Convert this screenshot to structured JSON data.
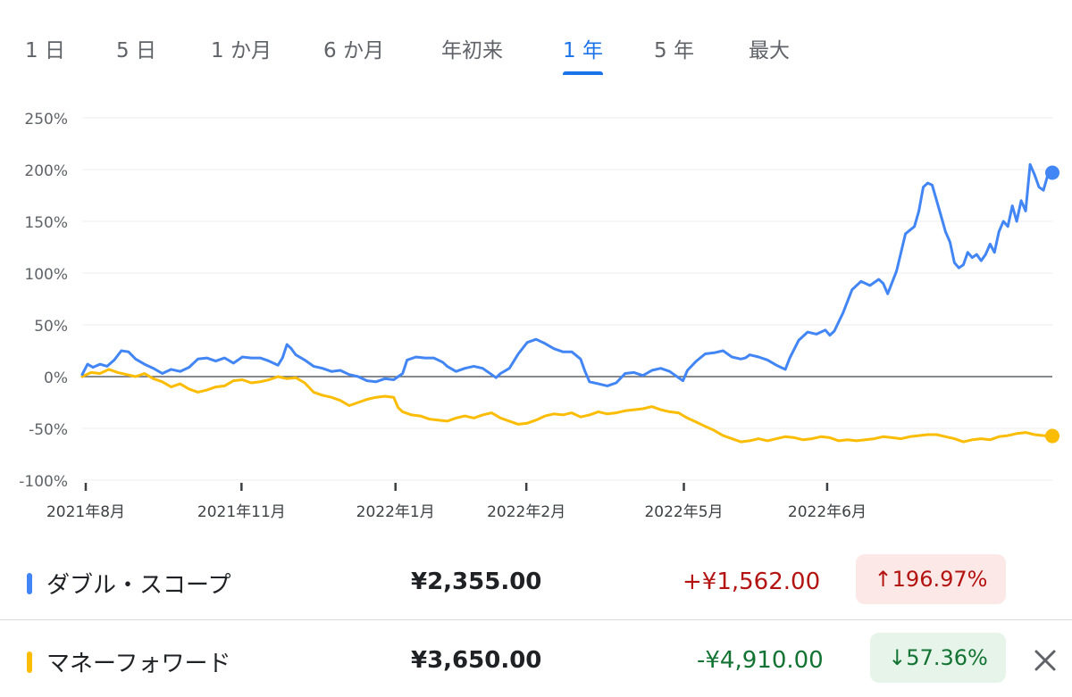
{
  "tabs": [
    {
      "label": "1 日",
      "active": false
    },
    {
      "label": "5 日",
      "active": false
    },
    {
      "label": "1 か月",
      "active": false
    },
    {
      "label": "6 か月",
      "active": false
    },
    {
      "label": "年初来",
      "active": false
    },
    {
      "label": "1 年",
      "active": true
    },
    {
      "label": "5 年",
      "active": false
    },
    {
      "label": "最大",
      "active": false
    }
  ],
  "colors": {
    "accent": "#1a73e8",
    "series_blue": "#4285f4",
    "series_yellow": "#fbbc04",
    "negative_text": "#b31412",
    "negative_badge_bg": "#fce8e6",
    "positive_text": "#137333",
    "positive_badge_bg": "#e6f4ea"
  },
  "chart_data": {
    "type": "line",
    "y_unit": "%",
    "ylim": [
      -100,
      250
    ],
    "yticks": [
      -100,
      -50,
      0,
      50,
      100,
      150,
      200,
      250
    ],
    "ytick_labels": [
      "-100%",
      "-50%",
      "0%",
      "50%",
      "100%",
      "150%",
      "200%",
      "250%"
    ],
    "xlim": [
      0,
      1
    ],
    "xticks": [
      {
        "pos": 0.004,
        "label": "2021年8月"
      },
      {
        "pos": 0.179,
        "label": "2021年11月"
      },
      {
        "pos": 0.352,
        "label": "2022年1月"
      },
      {
        "pos": 0.499,
        "label": "2022年2月"
      },
      {
        "pos": 0.676,
        "label": "2022年5月"
      },
      {
        "pos": 0.837,
        "label": "2022年6月"
      }
    ],
    "zero_line": true,
    "grid": true,
    "series": [
      {
        "name": "ダブル・スコープ",
        "color": "#4285f4",
        "end_marker": true,
        "points": [
          [
            0.0,
            2
          ],
          [
            0.006,
            12
          ],
          [
            0.012,
            9
          ],
          [
            0.02,
            12
          ],
          [
            0.028,
            10
          ],
          [
            0.036,
            16
          ],
          [
            0.044,
            25
          ],
          [
            0.052,
            24
          ],
          [
            0.06,
            17
          ],
          [
            0.07,
            12
          ],
          [
            0.08,
            8
          ],
          [
            0.09,
            3
          ],
          [
            0.1,
            7
          ],
          [
            0.11,
            5
          ],
          [
            0.12,
            9
          ],
          [
            0.13,
            17
          ],
          [
            0.14,
            18
          ],
          [
            0.15,
            15
          ],
          [
            0.16,
            18
          ],
          [
            0.17,
            13
          ],
          [
            0.18,
            19
          ],
          [
            0.19,
            18
          ],
          [
            0.2,
            18
          ],
          [
            0.21,
            15
          ],
          [
            0.22,
            11
          ],
          [
            0.225,
            18
          ],
          [
            0.23,
            31
          ],
          [
            0.235,
            27
          ],
          [
            0.24,
            21
          ],
          [
            0.25,
            16
          ],
          [
            0.26,
            10
          ],
          [
            0.27,
            8
          ],
          [
            0.28,
            5
          ],
          [
            0.29,
            6
          ],
          [
            0.3,
            2
          ],
          [
            0.31,
            0
          ],
          [
            0.32,
            -4
          ],
          [
            0.33,
            -5
          ],
          [
            0.34,
            -2
          ],
          [
            0.35,
            -3
          ],
          [
            0.355,
            0
          ],
          [
            0.36,
            3
          ],
          [
            0.365,
            16
          ],
          [
            0.375,
            19
          ],
          [
            0.385,
            18
          ],
          [
            0.395,
            18
          ],
          [
            0.405,
            14
          ],
          [
            0.41,
            10
          ],
          [
            0.42,
            5
          ],
          [
            0.43,
            8
          ],
          [
            0.44,
            10
          ],
          [
            0.45,
            8
          ],
          [
            0.46,
            2
          ],
          [
            0.465,
            -1
          ],
          [
            0.47,
            3
          ],
          [
            0.48,
            8
          ],
          [
            0.49,
            22
          ],
          [
            0.5,
            33
          ],
          [
            0.51,
            36
          ],
          [
            0.52,
            32
          ],
          [
            0.53,
            27
          ],
          [
            0.54,
            24
          ],
          [
            0.55,
            24
          ],
          [
            0.56,
            17
          ],
          [
            0.565,
            5
          ],
          [
            0.57,
            -5
          ],
          [
            0.58,
            -7
          ],
          [
            0.59,
            -9
          ],
          [
            0.6,
            -6
          ],
          [
            0.61,
            3
          ],
          [
            0.62,
            4
          ],
          [
            0.63,
            1
          ],
          [
            0.64,
            6
          ],
          [
            0.65,
            8
          ],
          [
            0.66,
            5
          ],
          [
            0.67,
            -1
          ],
          [
            0.675,
            -4
          ],
          [
            0.68,
            6
          ],
          [
            0.69,
            15
          ],
          [
            0.7,
            22
          ],
          [
            0.71,
            23
          ],
          [
            0.72,
            25
          ],
          [
            0.73,
            19
          ],
          [
            0.74,
            17
          ],
          [
            0.745,
            18
          ],
          [
            0.75,
            21
          ],
          [
            0.76,
            19
          ],
          [
            0.77,
            16
          ],
          [
            0.78,
            11
          ],
          [
            0.785,
            9
          ],
          [
            0.79,
            7
          ],
          [
            0.795,
            18
          ],
          [
            0.805,
            35
          ],
          [
            0.815,
            43
          ],
          [
            0.825,
            41
          ],
          [
            0.835,
            45
          ],
          [
            0.84,
            40
          ],
          [
            0.845,
            44
          ],
          [
            0.855,
            62
          ],
          [
            0.865,
            84
          ],
          [
            0.875,
            92
          ],
          [
            0.885,
            88
          ],
          [
            0.895,
            94
          ],
          [
            0.9,
            90
          ],
          [
            0.905,
            80
          ],
          [
            0.915,
            102
          ],
          [
            0.925,
            138
          ],
          [
            0.935,
            145
          ],
          [
            0.94,
            160
          ],
          [
            0.945,
            183
          ],
          [
            0.95,
            187
          ],
          [
            0.955,
            185
          ],
          [
            0.96,
            170
          ],
          [
            0.965,
            155
          ],
          [
            0.97,
            140
          ],
          [
            0.975,
            130
          ],
          [
            0.98,
            110
          ],
          [
            0.985,
            105
          ],
          [
            0.99,
            108
          ],
          [
            0.995,
            120
          ],
          [
            1.0,
            115
          ],
          [
            1.005,
            118
          ],
          [
            1.01,
            112
          ],
          [
            1.015,
            118
          ],
          [
            1.02,
            128
          ],
          [
            1.025,
            120
          ],
          [
            1.03,
            140
          ],
          [
            1.035,
            150
          ],
          [
            1.04,
            145
          ],
          [
            1.045,
            165
          ],
          [
            1.05,
            150
          ],
          [
            1.055,
            170
          ],
          [
            1.06,
            160
          ],
          [
            1.065,
            205
          ],
          [
            1.07,
            195
          ],
          [
            1.075,
            183
          ],
          [
            1.08,
            180
          ],
          [
            1.085,
            195
          ],
          [
            1.09,
            197
          ]
        ]
      },
      {
        "name": "マネーフォワード",
        "color": "#fbbc04",
        "end_marker": true,
        "points": [
          [
            0.0,
            0
          ],
          [
            0.01,
            4
          ],
          [
            0.02,
            3
          ],
          [
            0.03,
            7
          ],
          [
            0.04,
            4
          ],
          [
            0.05,
            2
          ],
          [
            0.06,
            0
          ],
          [
            0.07,
            3
          ],
          [
            0.08,
            -2
          ],
          [
            0.09,
            -5
          ],
          [
            0.1,
            -10
          ],
          [
            0.11,
            -7
          ],
          [
            0.12,
            -12
          ],
          [
            0.13,
            -15
          ],
          [
            0.14,
            -13
          ],
          [
            0.15,
            -10
          ],
          [
            0.16,
            -9
          ],
          [
            0.17,
            -4
          ],
          [
            0.18,
            -3
          ],
          [
            0.19,
            -6
          ],
          [
            0.2,
            -5
          ],
          [
            0.21,
            -3
          ],
          [
            0.22,
            0
          ],
          [
            0.23,
            -2
          ],
          [
            0.24,
            -1
          ],
          [
            0.25,
            -6
          ],
          [
            0.26,
            -15
          ],
          [
            0.27,
            -18
          ],
          [
            0.28,
            -20
          ],
          [
            0.29,
            -23
          ],
          [
            0.3,
            -28
          ],
          [
            0.31,
            -25
          ],
          [
            0.32,
            -22
          ],
          [
            0.33,
            -20
          ],
          [
            0.34,
            -19
          ],
          [
            0.35,
            -20
          ],
          [
            0.355,
            -30
          ],
          [
            0.36,
            -34
          ],
          [
            0.37,
            -37
          ],
          [
            0.38,
            -38
          ],
          [
            0.39,
            -41
          ],
          [
            0.4,
            -42
          ],
          [
            0.41,
            -43
          ],
          [
            0.42,
            -40
          ],
          [
            0.43,
            -38
          ],
          [
            0.44,
            -40
          ],
          [
            0.45,
            -37
          ],
          [
            0.46,
            -35
          ],
          [
            0.47,
            -40
          ],
          [
            0.48,
            -43
          ],
          [
            0.49,
            -46
          ],
          [
            0.5,
            -45
          ],
          [
            0.51,
            -42
          ],
          [
            0.52,
            -38
          ],
          [
            0.53,
            -36
          ],
          [
            0.54,
            -37
          ],
          [
            0.55,
            -35
          ],
          [
            0.56,
            -39
          ],
          [
            0.57,
            -37
          ],
          [
            0.58,
            -34
          ],
          [
            0.59,
            -36
          ],
          [
            0.6,
            -35
          ],
          [
            0.61,
            -33
          ],
          [
            0.62,
            -32
          ],
          [
            0.63,
            -31
          ],
          [
            0.64,
            -29
          ],
          [
            0.65,
            -32
          ],
          [
            0.66,
            -34
          ],
          [
            0.67,
            -35
          ],
          [
            0.68,
            -40
          ],
          [
            0.69,
            -44
          ],
          [
            0.7,
            -48
          ],
          [
            0.71,
            -52
          ],
          [
            0.72,
            -57
          ],
          [
            0.73,
            -60
          ],
          [
            0.74,
            -63
          ],
          [
            0.75,
            -62
          ],
          [
            0.76,
            -60
          ],
          [
            0.77,
            -62
          ],
          [
            0.78,
            -60
          ],
          [
            0.79,
            -58
          ],
          [
            0.8,
            -59
          ],
          [
            0.81,
            -61
          ],
          [
            0.82,
            -60
          ],
          [
            0.83,
            -58
          ],
          [
            0.84,
            -59
          ],
          [
            0.85,
            -62
          ],
          [
            0.86,
            -61
          ],
          [
            0.87,
            -62
          ],
          [
            0.88,
            -61
          ],
          [
            0.89,
            -60
          ],
          [
            0.9,
            -58
          ],
          [
            0.91,
            -59
          ],
          [
            0.92,
            -60
          ],
          [
            0.93,
            -58
          ],
          [
            0.94,
            -57
          ],
          [
            0.95,
            -56
          ],
          [
            0.96,
            -56
          ],
          [
            0.97,
            -58
          ],
          [
            0.98,
            -60
          ],
          [
            0.99,
            -63
          ],
          [
            1.0,
            -61
          ],
          [
            1.01,
            -60
          ],
          [
            1.02,
            -61
          ],
          [
            1.03,
            -58
          ],
          [
            1.04,
            -57
          ],
          [
            1.05,
            -55
          ],
          [
            1.06,
            -54
          ],
          [
            1.07,
            -56
          ],
          [
            1.08,
            -57
          ],
          [
            1.09,
            -57.36
          ]
        ]
      }
    ]
  },
  "legend": [
    {
      "name": "ダブル・スコープ",
      "color": "#4285f4",
      "price": "¥2,355.00",
      "change": "+¥1,562.00",
      "percent": "↑196.97%",
      "trend": "up",
      "removable": false
    },
    {
      "name": "マネーフォワード",
      "color": "#fbbc04",
      "price": "¥3,650.00",
      "change": "-¥4,910.00",
      "percent": "↓57.36%",
      "trend": "down",
      "removable": true,
      "close_icon": "close-icon"
    }
  ]
}
